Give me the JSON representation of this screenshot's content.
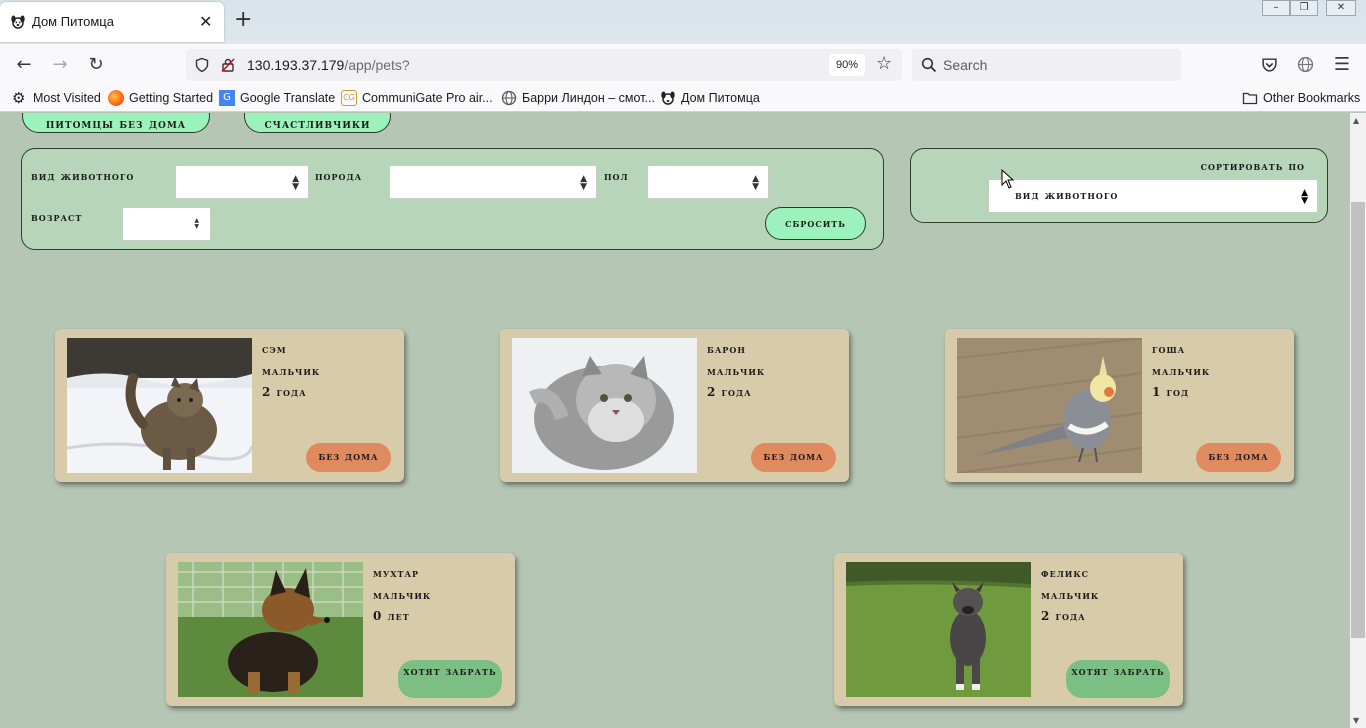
{
  "browser": {
    "tab_title": "Дом Питомца",
    "url_host": "130.193.37.179",
    "url_path": "/app/pets?",
    "zoom": "90%",
    "search_placeholder": "Search",
    "bookmarks": [
      "Most Visited",
      "Getting Started",
      "Google Translate",
      "CommuniGate Pro air...",
      "Барри Линдон – смот...",
      "Дом Питомца"
    ],
    "other_bookmarks": "Other Bookmarks"
  },
  "nav": {
    "homeless_label": "питомцы без дома",
    "lucky_label": "счастливчики"
  },
  "filters": {
    "species_label": "вид животного",
    "breed_label": "порода",
    "sex_label": "пол",
    "age_label": "возраст",
    "reset_label": "сбросить"
  },
  "sort": {
    "label": "сортировать по",
    "value": "вид животного"
  },
  "pets": [
    {
      "name": "сэм",
      "sex": "мальчик",
      "age": "2 года",
      "status": "без дома"
    },
    {
      "name": "барон",
      "sex": "мальчик",
      "age": "2 года",
      "status": "без дома"
    },
    {
      "name": "гоша",
      "sex": "мальчик",
      "age": "1 год",
      "status": "без дома"
    },
    {
      "name": "мухтар",
      "sex": "мальчик",
      "age": "0 лет",
      "status": "хотят забрать"
    },
    {
      "name": "феликс",
      "sex": "мальчик",
      "age": "2 года",
      "status": "хотят забрать"
    }
  ],
  "colors": {
    "page_bg": "#b5c6b5",
    "filter_bg": "#b7d5b9",
    "card_bg": "#d8cba9",
    "accent_green": "#9cf2bb",
    "status_homeless": "#e08a5f",
    "status_wanted": "#7cbf84"
  }
}
